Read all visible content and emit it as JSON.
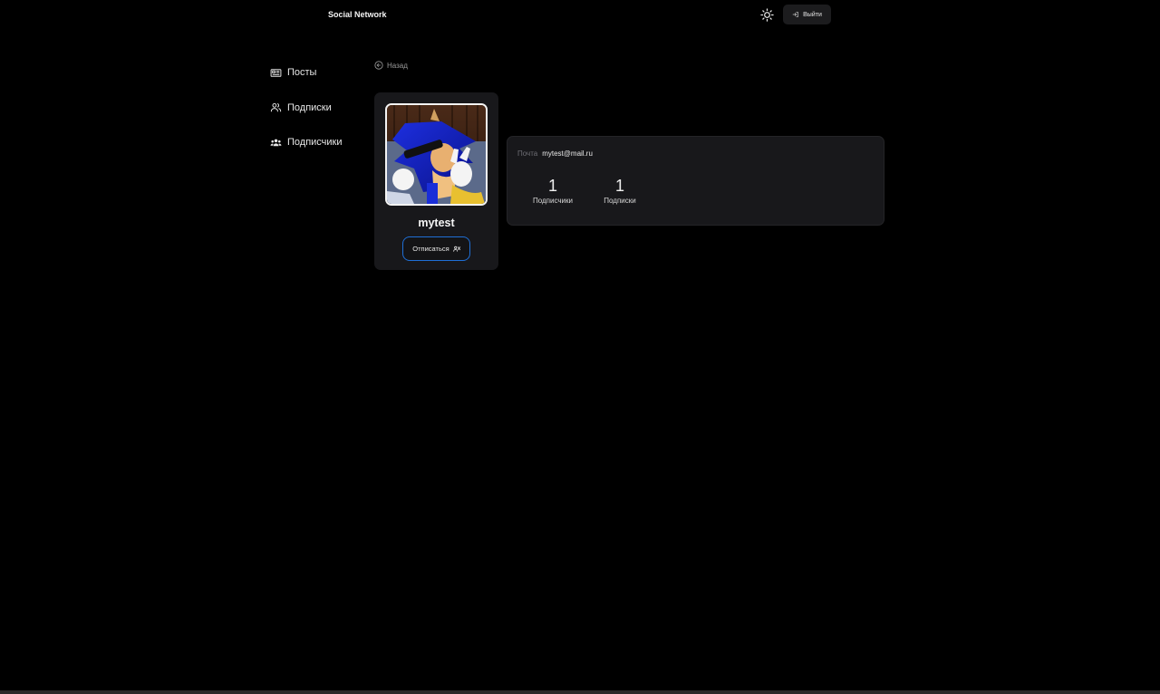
{
  "header": {
    "brand": "Social Network",
    "logout_label": "Выйти",
    "theme_icon": "sun-icon"
  },
  "sidebar": {
    "items": [
      {
        "label": "Посты",
        "icon": "newspaper-icon"
      },
      {
        "label": "Подписки",
        "icon": "users-outline-icon"
      },
      {
        "label": "Подписчики",
        "icon": "users-solid-icon"
      }
    ]
  },
  "back_label": "Назад",
  "profile": {
    "username": "mytest",
    "unsubscribe_label": "Отписаться",
    "email_label": "Почта",
    "email": "mytest@mail.ru",
    "stats": [
      {
        "value": "1",
        "label": "Подписчики"
      },
      {
        "value": "1",
        "label": "Подписки"
      }
    ]
  },
  "colors": {
    "background": "#000000",
    "card": "#18181b",
    "accent": "#1f6fd6"
  }
}
